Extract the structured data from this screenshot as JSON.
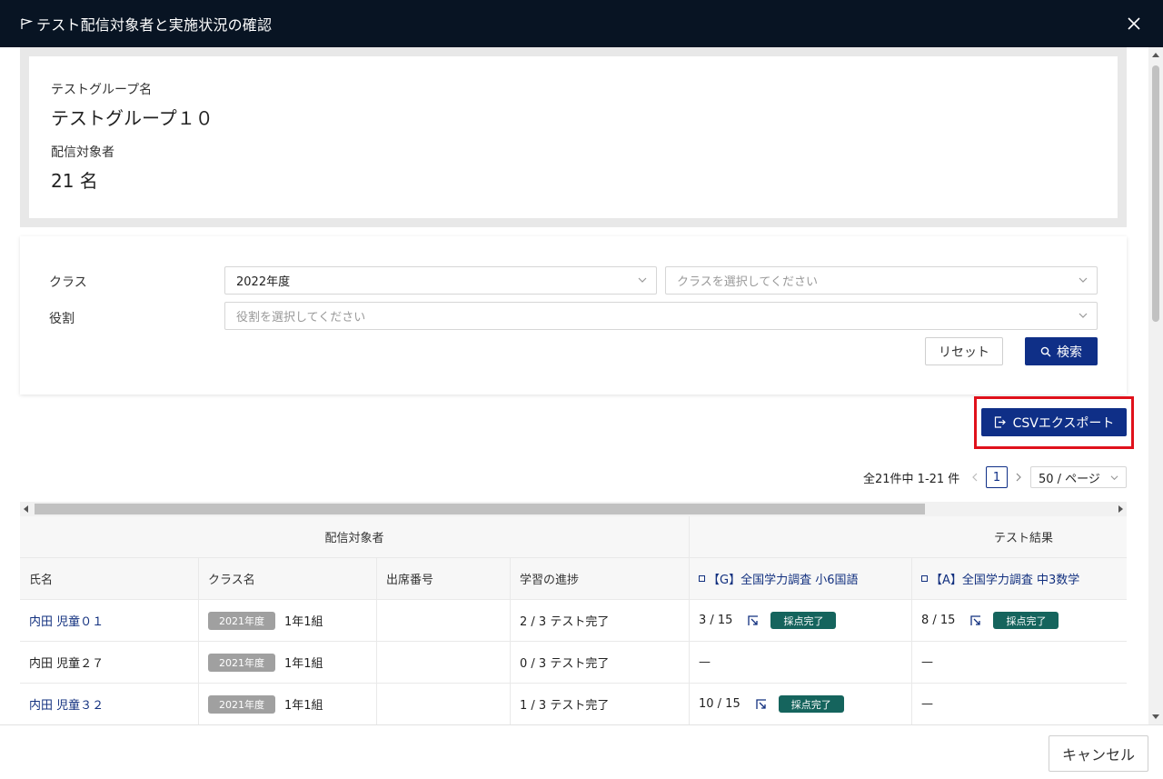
{
  "modal": {
    "title": "テスト配信対象者と実施状況の確認"
  },
  "info": {
    "group_label": "テストグループ名",
    "group_value": "テストグループ１０",
    "target_label": "配信対象者",
    "target_value": "21 名"
  },
  "filters": {
    "class_label": "クラス",
    "year_value": "2022年度",
    "class_placeholder": "クラスを選択してください",
    "role_label": "役割",
    "role_placeholder": "役割を選択してください",
    "reset_label": "リセット",
    "search_label": "検索"
  },
  "export": {
    "csv_label": "CSVエクスポート"
  },
  "pager": {
    "summary": "全21件中 1-21 件",
    "prev": "<",
    "current_page": "1",
    "next": ">",
    "page_size": "50 / ページ"
  },
  "table": {
    "group_headers": {
      "targets": "配信対象者",
      "results": "テスト結果"
    },
    "columns": {
      "name": "氏名",
      "class": "クラス名",
      "attendance": "出席番号",
      "progress": "学習の進捗",
      "test_g": "【G】全国学力調査 小6国語",
      "test_a": "【A】全国学力調査 中3数学"
    },
    "rows": [
      {
        "name": "内田 児童０１",
        "name_link": true,
        "year": "2021年度",
        "class": "1年1組",
        "attendance": "",
        "progress": "2 / 3 テスト完了",
        "g_score": "3 / 15",
        "g_status": "採点完了",
        "a_score": "8 / 15",
        "a_status": "採点完了"
      },
      {
        "name": "内田 児童２７",
        "name_link": false,
        "year": "2021年度",
        "class": "1年1組",
        "attendance": "",
        "progress": "0 / 3 テスト完了",
        "g_score": "—",
        "g_status": "",
        "a_score": "—",
        "a_status": ""
      },
      {
        "name": "内田 児童３２",
        "name_link": true,
        "year": "2021年度",
        "class": "1年1組",
        "attendance": "",
        "progress": "1 / 3 テスト完了",
        "g_score": "10 / 15",
        "g_status": "採点完了",
        "a_score": "—",
        "a_status": ""
      }
    ]
  },
  "footer": {
    "cancel_label": "キャンセル"
  },
  "colors": {
    "titlebar_bg": "#081423",
    "primary": "#0f2f87",
    "status_tag": "#15645d",
    "highlight": "#e0111b"
  }
}
